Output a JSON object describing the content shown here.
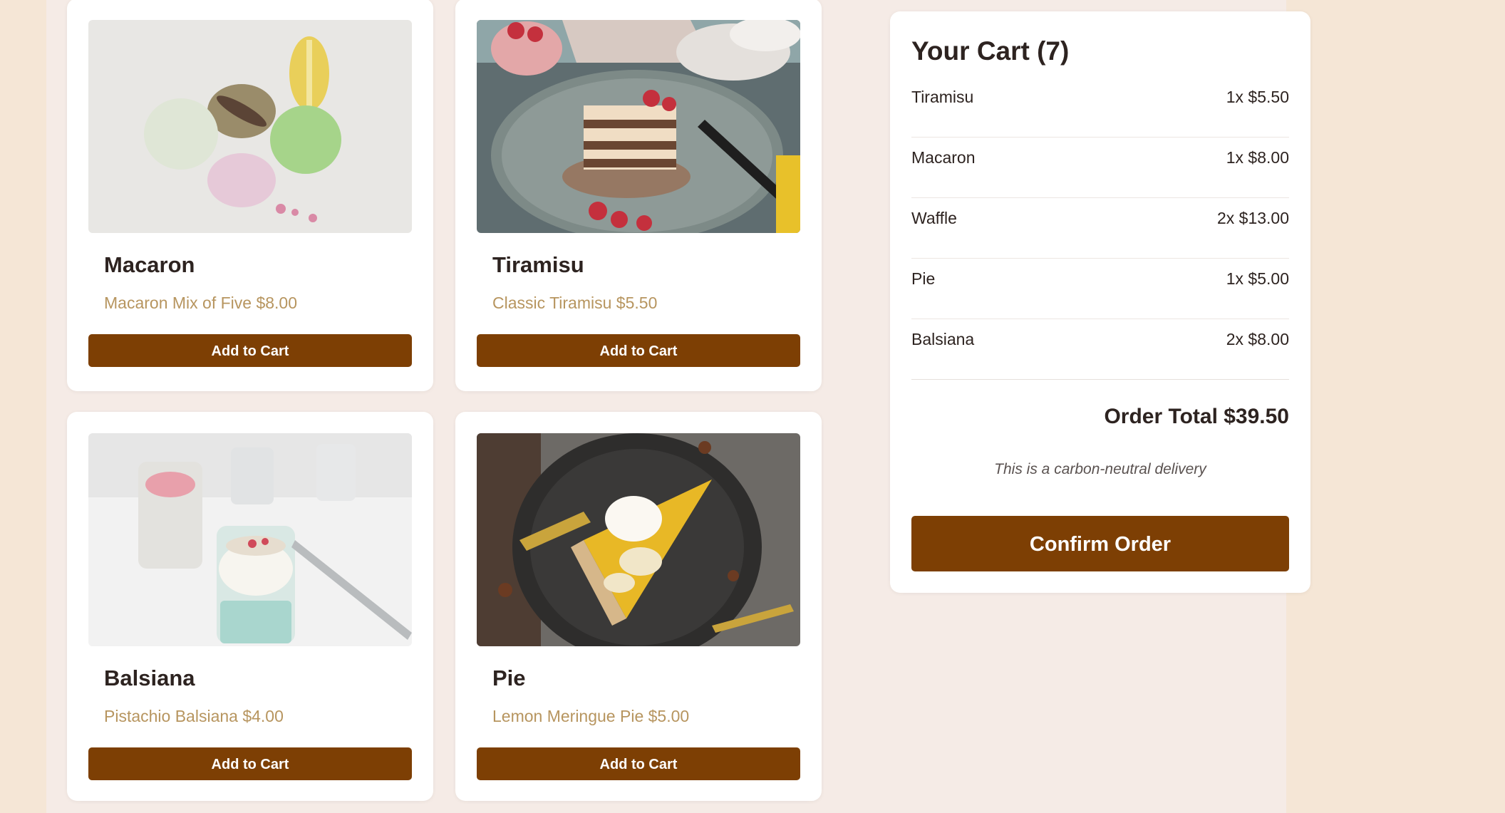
{
  "colors": {
    "page_background": "#f5e6d6",
    "content_background": "#f5ebe6",
    "card_background": "#ffffff",
    "button": "#7d3f04",
    "description_text": "#b7955f",
    "heading_text": "#2d2320"
  },
  "products": [
    {
      "name": "Macaron",
      "description": "Macaron Mix of Five $8.00",
      "button_label": "Add to Cart",
      "image": "macaron-photo"
    },
    {
      "name": "Tiramisu",
      "description": "Classic Tiramisu $5.50",
      "button_label": "Add to Cart",
      "image": "tiramisu-photo"
    },
    {
      "name": "Balsiana",
      "description": "Pistachio Balsiana $4.00",
      "button_label": "Add to Cart",
      "image": "balsiana-photo"
    },
    {
      "name": "Pie",
      "description": "Lemon Meringue Pie $5.00",
      "button_label": "Add to Cart",
      "image": "pie-photo"
    }
  ],
  "cart": {
    "title": "Your Cart (7)",
    "items": [
      {
        "name": "Tiramisu",
        "price": "1x $5.50"
      },
      {
        "name": "Macaron",
        "price": "1x $8.00"
      },
      {
        "name": "Waffle",
        "price": "2x $13.00"
      },
      {
        "name": "Pie",
        "price": "1x $5.00"
      },
      {
        "name": "Balsiana",
        "price": "2x $8.00"
      }
    ],
    "total": "Order Total $39.50",
    "note": "This is a carbon-neutral delivery",
    "confirm_label": "Confirm Order"
  }
}
